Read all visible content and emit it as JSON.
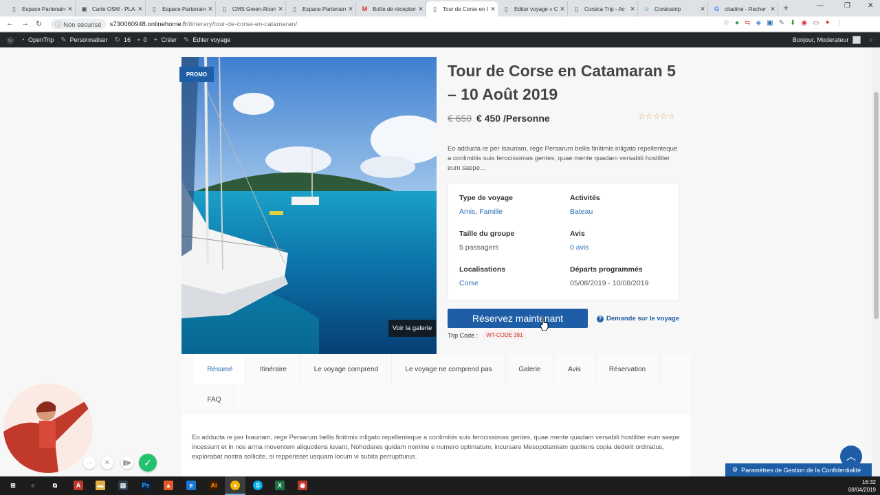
{
  "browser": {
    "tabs": [
      {
        "label": "Espace Partenaire",
        "icon": "document-icon"
      },
      {
        "label": "Carte OSM - PLAN",
        "icon": "map-icon"
      },
      {
        "label": "Espace Partenaire",
        "icon": "document-icon"
      },
      {
        "label": "CMS Green-Room",
        "icon": "document-icon"
      },
      {
        "label": "Espace Partenaire",
        "icon": "document-icon"
      },
      {
        "label": "Boîte de réception",
        "icon": "gmail-icon"
      },
      {
        "label": "Tour de Corse en C",
        "icon": "document-icon",
        "active": true
      },
      {
        "label": "Editer voyage « C",
        "icon": "document-icon"
      },
      {
        "label": "Corsica Trip - Ac",
        "icon": "document-icon"
      },
      {
        "label": "Corsicatrip",
        "icon": "person-icon"
      },
      {
        "label": "citadine - Recher",
        "icon": "google-icon"
      }
    ],
    "security_label": "Non sécurisé",
    "url_host": "s730060948.onlinehome.fr",
    "url_path": "/itinerary/tour-de-corse-en-catamaran/"
  },
  "wpbar": {
    "site": "OpenTrip",
    "customize": "Personnaliser",
    "updates": "16",
    "comments": "0",
    "create": "Créer",
    "edit": "Editer voyage",
    "greeting": "Bonjour, Moderateur"
  },
  "trip": {
    "badge": "PROMO",
    "gallery_button": "Voir la galerie",
    "title": "Tour de Corse en Catamaran 5 – 10 Août 2019",
    "old_price": "€ 650",
    "new_price": "€ 450 /Personne",
    "rating_stars": 0,
    "excerpt": "Eo adducta re per Isauriam, rege Persarum bellis finitimis inligato repellenteque a conlimitiis suis ferocissimas gentes, quae mente quadam versabili hostiliter eum saepe…",
    "info": {
      "type_label": "Type de voyage",
      "type_value_1": "Amis",
      "type_sep": ", ",
      "type_value_2": "Famille",
      "activities_label": "Activités",
      "activities_value": "Bateau",
      "group_label": "Taille du groupe",
      "group_value": "5 passagers",
      "reviews_label": "Avis",
      "reviews_value": "0 avis",
      "locations_label": "Localisations",
      "locations_value": "Corse",
      "departures_label": "Départs programmés",
      "departures_value": "05/08/2019 - 10/08/2019"
    },
    "book_button": "Réservez maintenant",
    "enquiry": "Demande sur le voyage",
    "trip_code_label": "Trip Code :",
    "trip_code": "WT-CODE 381"
  },
  "tabs": [
    "Résumé",
    "Itinéraire",
    "Le voyage comprend",
    "Le voyage ne comprend pas",
    "Galerie",
    "Avis",
    "Réservation",
    "FAQ"
  ],
  "description": "Eo adducta re per Isauriam, rege Persarum bellis finitimis inligato repellenteque a conlimitiis suis ferocissimas gentes, quae mente quadam versabili hostiliter eum saepe incessunt et in nos arma moventem aliquotiens iuvant, Nohodares quidam nomine e numero optimatum, incursare Mesopotamiam quotiens copia dederit ordinatus, explorabat nostra sollicite, si repperisset usquam locum vi subita perruptturus.",
  "privacy_button": "Paramètres de Gestion de la Confidentialité",
  "clock": {
    "time": "16:32",
    "date": "08/04/2019"
  },
  "colors": {
    "accent": "#1e5ea7",
    "link": "#2a6db5",
    "success": "#22c26e"
  }
}
